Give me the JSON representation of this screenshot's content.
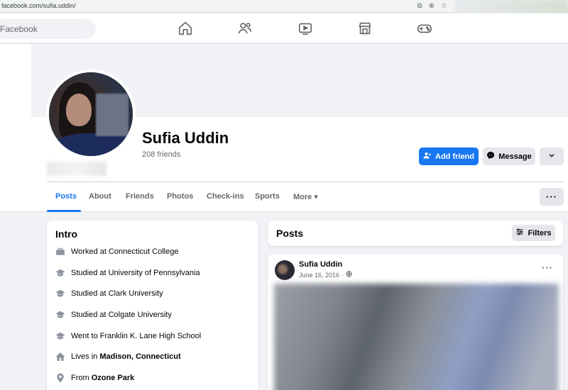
{
  "browser": {
    "url": "facebook.com/sufia.uddin/"
  },
  "nav": {
    "search_placeholder": "Facebook",
    "icons": [
      "home-icon",
      "friends-icon",
      "watch-icon",
      "marketplace-icon",
      "gaming-icon"
    ]
  },
  "profile": {
    "name": "Sufia Uddin",
    "friends": "208 friends",
    "add_friend_label": "Add friend",
    "message_label": "Message"
  },
  "tabs": [
    {
      "label": "Posts",
      "active": true
    },
    {
      "label": "About"
    },
    {
      "label": "Friends"
    },
    {
      "label": "Photos"
    },
    {
      "label": "Check-ins"
    },
    {
      "label": "Sports"
    },
    {
      "label": "More"
    }
  ],
  "intro": {
    "title": "Intro",
    "items": [
      {
        "icon": "briefcase-icon",
        "text": "Worked at Connecticut College"
      },
      {
        "icon": "graduation-cap-icon",
        "text": "Studied at University of Pennsylvania"
      },
      {
        "icon": "graduation-cap-icon",
        "text": "Studied at Clark University"
      },
      {
        "icon": "graduation-cap-icon",
        "text": "Studied at Colgate University"
      },
      {
        "icon": "graduation-cap-icon",
        "text": "Went to Franklin K. Lane High School"
      },
      {
        "icon": "house-icon",
        "prefix": "Lives in ",
        "bold": "Madison, Connecticut"
      },
      {
        "icon": "location-pin-icon",
        "prefix": "From ",
        "bold": "Ozone Park"
      }
    ]
  },
  "posts": {
    "title": "Posts",
    "filters_label": "Filters",
    "post": {
      "author": "Sufia Uddin",
      "date": "June 16, 2016",
      "separator": "·"
    }
  },
  "colors": {
    "accent": "#1877f2",
    "background": "#f0f2f5",
    "secondary_button": "#e4e6eb",
    "muted_text": "#65676b"
  }
}
